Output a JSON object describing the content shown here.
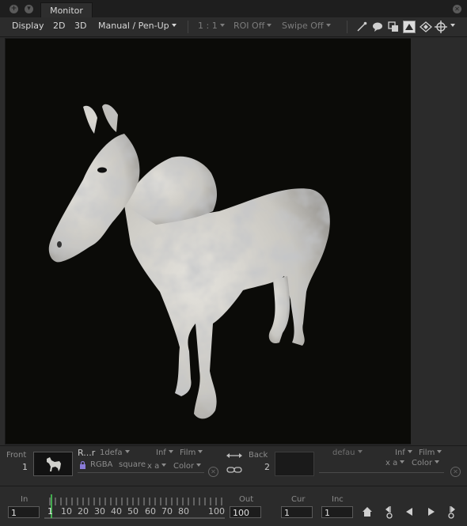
{
  "window": {
    "tab_title": "Monitor",
    "tab_close": "✕"
  },
  "toolbar": {
    "display": "Display",
    "mode_2d": "2D",
    "mode_3d": "3D",
    "view_mode": "Manual / Pen-Up",
    "zoom": "1 : 1",
    "roi": "ROI Off",
    "swipe": "Swipe Off"
  },
  "front": {
    "label": "Front",
    "index": "1",
    "name": "R...r",
    "default": "1defa",
    "channels": "RGBA",
    "aspect": "square",
    "inf": "Inf",
    "film": "Film",
    "xa": "x a",
    "color": "Color"
  },
  "back": {
    "label": "Back",
    "index": "2",
    "default": "defau",
    "inf": "Inf",
    "film": "Film",
    "xa": "x a",
    "color": "Color"
  },
  "timeline": {
    "in_label": "In",
    "in_value": "1",
    "out_label": "Out",
    "out_value": "100",
    "cur_label": "Cur",
    "cur_value": "1",
    "inc_label": "Inc",
    "inc_value": "1",
    "ticks": [
      "1",
      "10",
      "20",
      "30",
      "40",
      "50",
      "60",
      "70",
      "80",
      "100"
    ]
  }
}
